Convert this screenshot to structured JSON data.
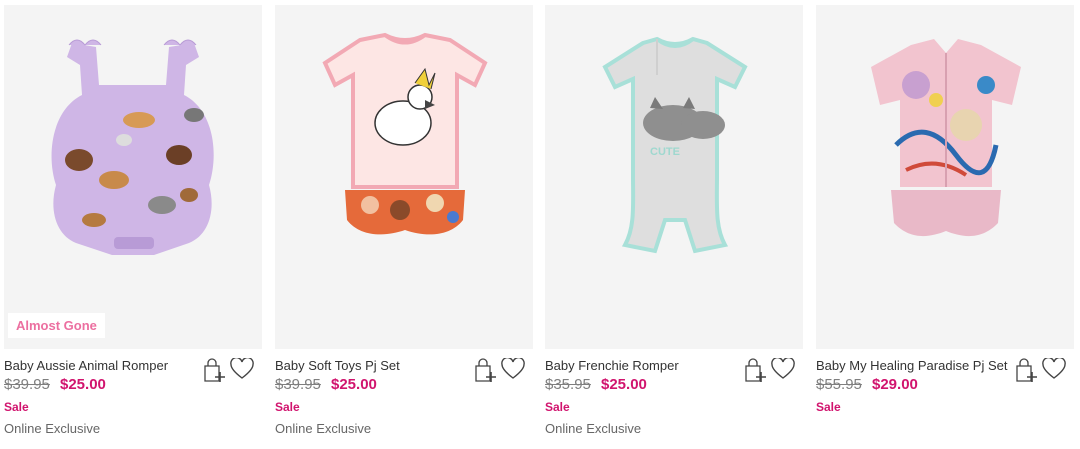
{
  "products": [
    {
      "name": "Baby Aussie Animal Romper",
      "was_price": "$39.95",
      "price": "$25.00",
      "sale": "Sale",
      "tag": "Online Exclusive",
      "badge": "Almost Gone",
      "bag_icon": "add-to-bag-icon",
      "heart_icon": "wishlist-heart-icon"
    },
    {
      "name": "Baby Soft Toys Pj Set",
      "was_price": "$39.95",
      "price": "$25.00",
      "sale": "Sale",
      "tag": "Online Exclusive",
      "bag_icon": "add-to-bag-icon",
      "heart_icon": "wishlist-heart-icon"
    },
    {
      "name": "Baby Frenchie Romper",
      "was_price": "$35.95",
      "price": "$25.00",
      "sale": "Sale",
      "tag": "Online Exclusive",
      "bag_icon": "add-to-bag-icon",
      "heart_icon": "wishlist-heart-icon"
    },
    {
      "name": "Baby My Healing Paradise Pj Set",
      "was_price": "$55.95",
      "price": "$29.00",
      "sale": "Sale",
      "bag_icon": "add-to-bag-icon",
      "heart_icon": "wishlist-heart-icon"
    }
  ],
  "colors": {
    "sale_price": "#d1146e",
    "was_price": "#7f7f7f",
    "badge_text": "#ec6fa0",
    "image_bg": "#f4f4f4"
  }
}
